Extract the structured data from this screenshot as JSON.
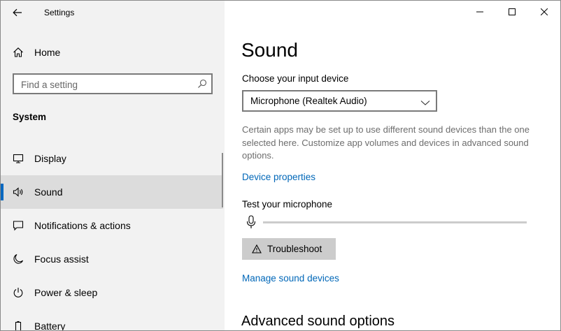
{
  "window": {
    "title": "Settings",
    "controls": [
      "minimize",
      "maximize",
      "close"
    ]
  },
  "sidebar": {
    "home_label": "Home",
    "search": {
      "placeholder": "Find a setting",
      "value": ""
    },
    "section_title": "System",
    "items": [
      {
        "label": "Display",
        "icon": "monitor-icon",
        "selected": false
      },
      {
        "label": "Sound",
        "icon": "speaker-icon",
        "selected": true
      },
      {
        "label": "Notifications & actions",
        "icon": "notifications-icon",
        "selected": false
      },
      {
        "label": "Focus assist",
        "icon": "moon-icon",
        "selected": false
      },
      {
        "label": "Power & sleep",
        "icon": "power-icon",
        "selected": false
      },
      {
        "label": "Battery",
        "icon": "battery-icon",
        "selected": false
      }
    ]
  },
  "main": {
    "title": "Sound",
    "input_device_label": "Choose your input device",
    "input_device_value": "Microphone (Realtek Audio)",
    "description": "Certain apps may be set up to use different sound devices than the one selected here. Customize app volumes and devices in advanced sound options.",
    "device_properties_link": "Device properties",
    "test_mic_label": "Test your microphone",
    "mic_level": 0,
    "troubleshoot_label": "Troubleshoot",
    "manage_devices_link": "Manage sound devices",
    "advanced_heading": "Advanced sound options"
  },
  "colors": {
    "accent": "#0067c0",
    "link": "#0067b8",
    "sidebar_bg": "#f2f2f2",
    "selected_bg": "#dcdcdc"
  }
}
